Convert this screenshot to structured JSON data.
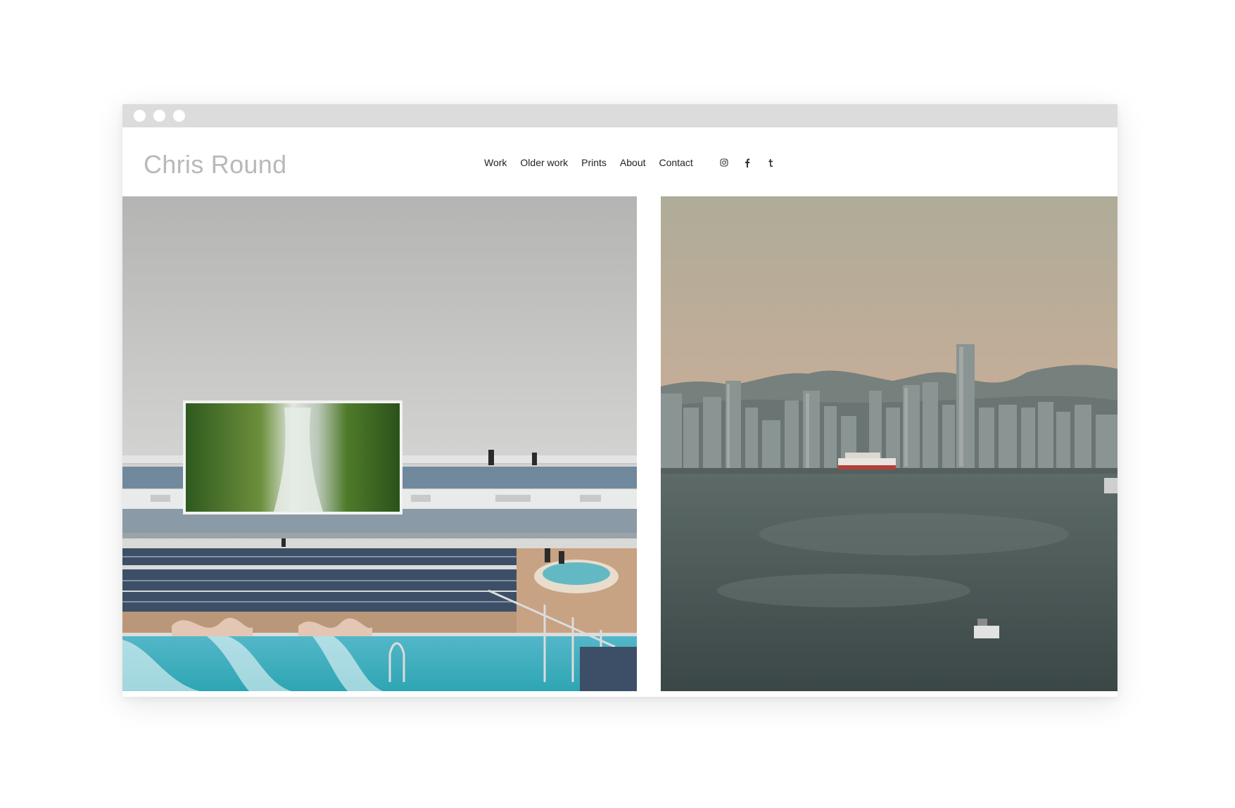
{
  "site": {
    "title": "Chris Round",
    "nav": [
      {
        "label": "Work"
      },
      {
        "label": "Older work"
      },
      {
        "label": "Prints"
      },
      {
        "label": "About"
      },
      {
        "label": "Contact"
      }
    ],
    "social": [
      {
        "icon": "instagram-icon"
      },
      {
        "icon": "facebook-icon"
      },
      {
        "icon": "tumblr-icon"
      }
    ]
  },
  "gallery": [
    {
      "subject": "cruise ship pool deck with waterfall screen"
    },
    {
      "subject": "city skyline across harbour at dusk"
    }
  ]
}
